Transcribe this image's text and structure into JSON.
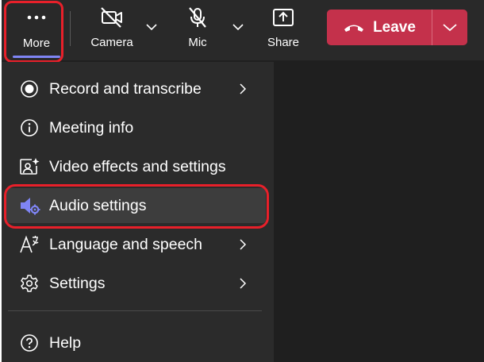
{
  "toolbar": {
    "more_label": "More",
    "camera_label": "Camera",
    "mic_label": "Mic",
    "share_label": "Share",
    "leave_label": "Leave"
  },
  "menu": {
    "items": [
      {
        "label": "Record and transcribe",
        "icon": "record-icon",
        "has_submenu": true
      },
      {
        "label": "Meeting info",
        "icon": "info-icon",
        "has_submenu": false
      },
      {
        "label": "Video effects and settings",
        "icon": "video-effects-icon",
        "has_submenu": false
      },
      {
        "label": "Audio settings",
        "icon": "audio-settings-icon",
        "has_submenu": false,
        "highlighted": true
      },
      {
        "label": "Language and speech",
        "icon": "language-icon",
        "has_submenu": true
      },
      {
        "label": "Settings",
        "icon": "gear-icon",
        "has_submenu": true
      },
      {
        "label": "Help",
        "icon": "help-icon",
        "has_submenu": false
      }
    ]
  },
  "colors": {
    "leave_button": "#c4314b",
    "accent": "#7f85f5",
    "annotation_red": "#e8202a",
    "toolbar_bg": "#292929",
    "menu_bg": "#2b2b2b"
  }
}
